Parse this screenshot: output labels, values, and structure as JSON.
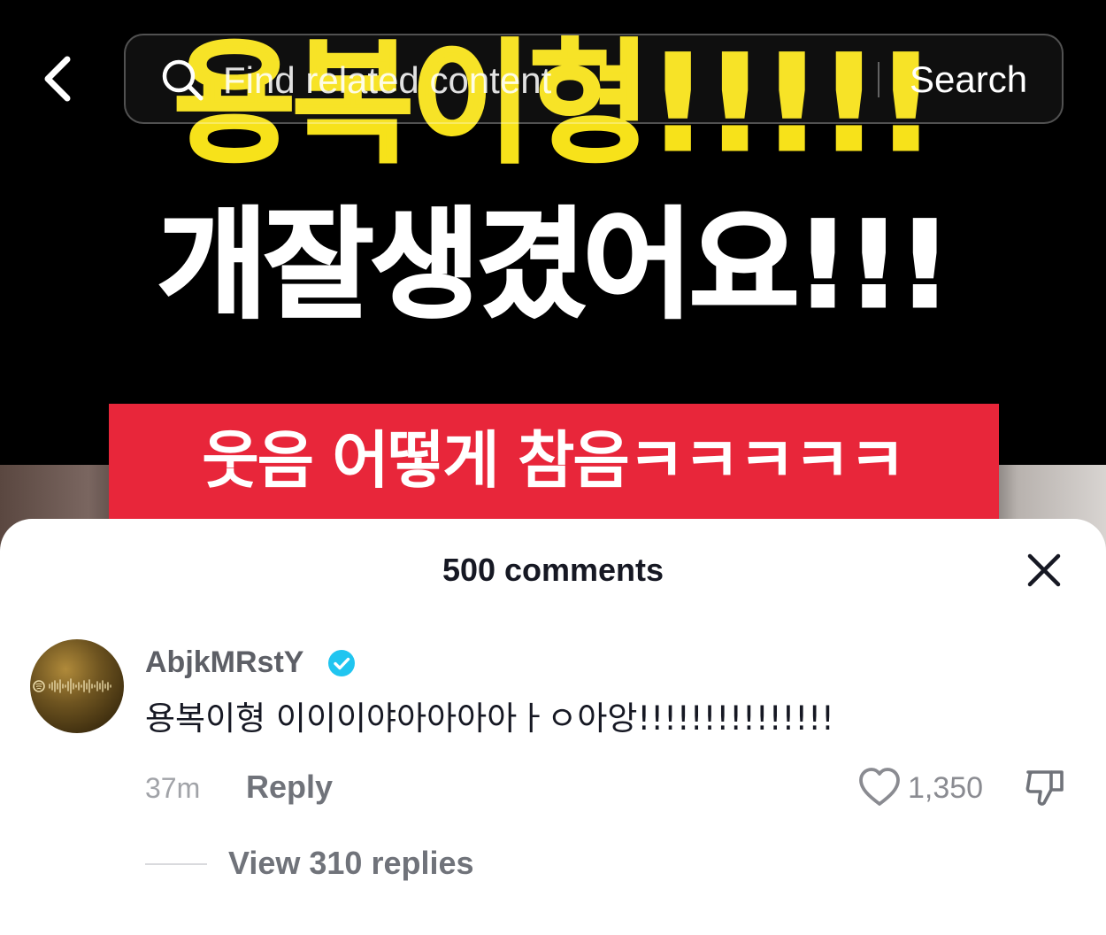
{
  "video": {
    "caption_line1": "용복이형!!!!!",
    "caption_line2": "개잘생겼어요!!!",
    "caption_line3": "웃음 어떻게 참음ㅋㅋㅋㅋㅋ"
  },
  "top_bar": {
    "back_icon": "chevron-left-icon",
    "search_placeholder": "Find related content",
    "search_button_label": "Search",
    "search_icon": "search-icon"
  },
  "comments_sheet": {
    "title": "500 comments",
    "close_icon": "close-icon",
    "comment": {
      "username": "AbjkMRstY",
      "verified": true,
      "verified_badge_color": "#20c5f0",
      "text": "용복이형 이이이야아아아아ㅏㅇ아앙!!!!!!!!!!!!!!!",
      "time": "37m",
      "reply_label": "Reply",
      "like_count": "1,350",
      "view_replies_label": "View 310 replies"
    }
  },
  "colors": {
    "caption_yellow": "#f7e21a",
    "caption_band_red": "#e8263a",
    "text_primary": "#161823",
    "text_secondary": "#70737a"
  }
}
